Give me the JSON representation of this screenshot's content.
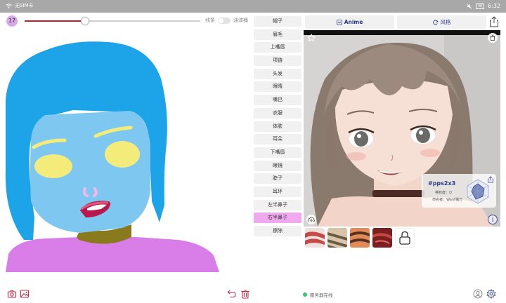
{
  "status_bar": {
    "carrier": "无SIM卡",
    "time": "6:32",
    "battery_level": "48"
  },
  "brush": {
    "size": "17",
    "slider_value": 0.34
  },
  "modes": {
    "line_label": "线条",
    "fill_label": "油漆桶"
  },
  "parts": [
    {
      "label": "帽子",
      "selected": false
    },
    {
      "label": "眉毛",
      "selected": false
    },
    {
      "label": "上嘴唇",
      "selected": false
    },
    {
      "label": "项链",
      "selected": false
    },
    {
      "label": "头发",
      "selected": false
    },
    {
      "label": "眼睛",
      "selected": false
    },
    {
      "label": "嘴巴",
      "selected": false
    },
    {
      "label": "衣服",
      "selected": false
    },
    {
      "label": "体肤",
      "selected": false
    },
    {
      "label": "耳朵",
      "selected": false
    },
    {
      "label": "下嘴唇",
      "selected": false
    },
    {
      "label": "眼镜",
      "selected": false
    },
    {
      "label": "脖子",
      "selected": false
    },
    {
      "label": "耳环",
      "selected": false
    },
    {
      "label": "左半鼻子",
      "selected": false
    },
    {
      "label": "右半鼻子",
      "selected": true
    },
    {
      "label": "擦除",
      "selected": false
    }
  ],
  "tabs": {
    "anime_label": "Anime",
    "style_label": "风格"
  },
  "result_card": {
    "tag": "#pps2x3",
    "line1": "稀有度：D",
    "line2": "命名者：Want猫万"
  },
  "server_status": "服务器在线",
  "colors": {
    "accent_pink": "#f0a8ee",
    "slider_red": "#c0202a",
    "tab_text": "#2a3a8a",
    "online_green": "#3cc46a",
    "hair_blue": "#1da3e8",
    "skin_blue": "#7ec7f0",
    "clothes_purple": "#d97ee9",
    "neck_olive": "#8a7a1e"
  },
  "icons": {
    "camera": "camera-icon",
    "gallery": "image-icon",
    "undo": "undo-icon",
    "delete": "trash-icon",
    "user": "user-icon",
    "settings": "gear-icon"
  }
}
